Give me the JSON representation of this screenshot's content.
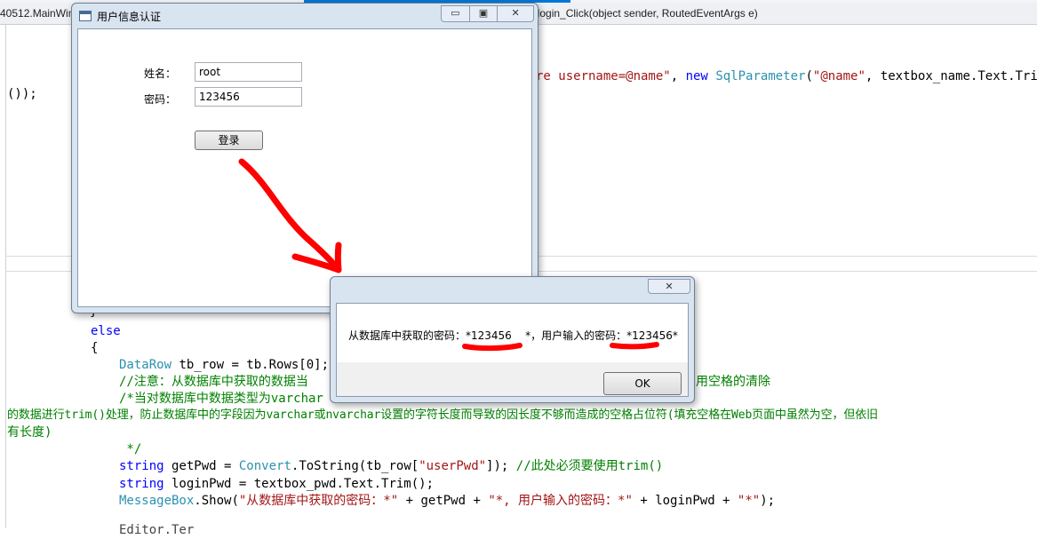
{
  "ide": {
    "tab_left": "40512.MainWin",
    "tab_right": "_login_Click(object sender, RoutedEventArgs e)",
    "code": {
      "l1_str": "re username=@name\"",
      "l1_comma1": ", ",
      "l1_new": "new",
      "l1_sp": " ",
      "l1_type": "SqlParameter",
      "l1_open": "(",
      "l1_str2": "\"@name\"",
      "l1_rest": ", textbox_name.Text.Trim",
      "l2": "()); ",
      "l3": "}",
      "l4": "else",
      "l5": "{",
      "l6_type": "DataRow",
      "l6_rest": " tb_row = tb.Rows[0];",
      "l7_a": "//注意：从数据库中获取的数据当",
      "l7_b": "用空格的清除",
      "l8": "/*当对数据库中数据类型为varchar",
      "l9": "的数据进行trim()处理，防止数据库中的字段因为varchar或nvarchar设置的字符长度而导致的因长度不够而造成的空格占位符(填充空格在Web页面中虽然为空，但依旧",
      "l10": "有长度)",
      "l11": " */",
      "l12_kw": "string",
      "l12_a": " getPwd = ",
      "l12_type": "Convert",
      "l12_b": ".ToString(tb_row[",
      "l12_str": "\"userPwd\"",
      "l12_c": "]); ",
      "l12_cm": "//此处必须要使用trim()",
      "l13_kw": "string",
      "l13_rest": " loginPwd = textbox_pwd.Text.Trim();",
      "l14_type": "MessageBox",
      "l14_a": ".Show(",
      "l14_s1": "\"从数据库中获取的密码：*\"",
      "l14_b": " + getPwd + ",
      "l14_s2": "\"*, 用户输入的密码：*\"",
      "l14_c": " + loginPwd + ",
      "l14_s3": "\"*\"",
      "l14_d": ");",
      "l15": "Editor.Ter"
    }
  },
  "login_window": {
    "title": "用户信息认证",
    "controls": {
      "minimize": "▭",
      "maximize": "▣",
      "close": "✕"
    },
    "name_label": "姓名：",
    "name_value": "root",
    "pwd_label": "密码：",
    "pwd_value": "123456",
    "login_button": "登录"
  },
  "message_box": {
    "close": "✕",
    "text": "从数据库中获取的密码：*123456    *，用户输入的密码：*123456*",
    "ok_button": "OK"
  },
  "colors": {
    "annotation_red": "#ff0000",
    "window_frame": "#d9e4f1",
    "ide_accent": "#0078d7"
  }
}
